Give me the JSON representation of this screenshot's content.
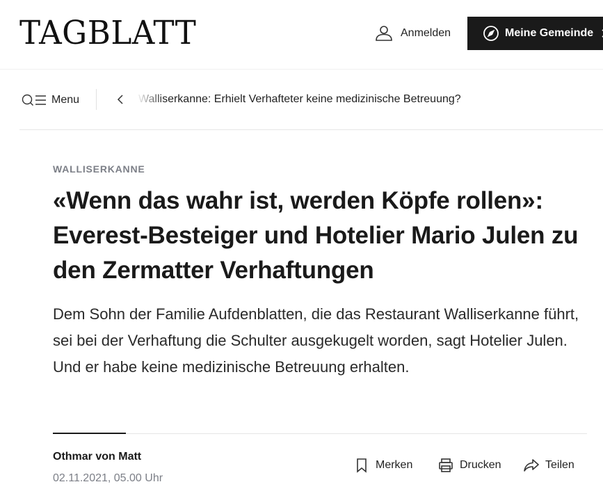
{
  "header": {
    "logo": "TAGBLATT",
    "login_label": "Anmelden",
    "login_icon": "user-icon",
    "community_label": "Meine Gemeinde",
    "community_icon": "compass-icon",
    "community_chevron_icon": "chevron-right-icon"
  },
  "nav": {
    "menu_label": "Menu",
    "menu_icon": "search-menu-icon",
    "back_icon": "chevron-left-icon",
    "breadcrumb": "Walliserkanne: Erhielt Verhafteter keine medizinische Betreuung?"
  },
  "article": {
    "kicker": "WALLISERKANNE",
    "headline": "«Wenn das wahr ist, werden Köpfe rollen»: Everest-Besteiger und Hotelier Mario Julen zu den Zermatter Verhaftungen",
    "lead": "Dem Sohn der Familie Aufdenblatten, die das Restaurant Walliserkanne führt, sei bei der Verhaftung die Schulter ausgekugelt worden, sagt Hotelier Julen. Und er habe keine medizinische Betreuung erhalten.",
    "author": "Othmar von Matt",
    "date": "02.11.2021, 05.00 Uhr"
  },
  "actions": {
    "bookmark_label": "Merken",
    "print_label": "Drucken",
    "share_label": "Teilen"
  },
  "colors": {
    "text": "#1a1a1a",
    "muted": "#7c7f87",
    "button_dark": "#1a1a1a",
    "divider": "#e6e6e6"
  }
}
